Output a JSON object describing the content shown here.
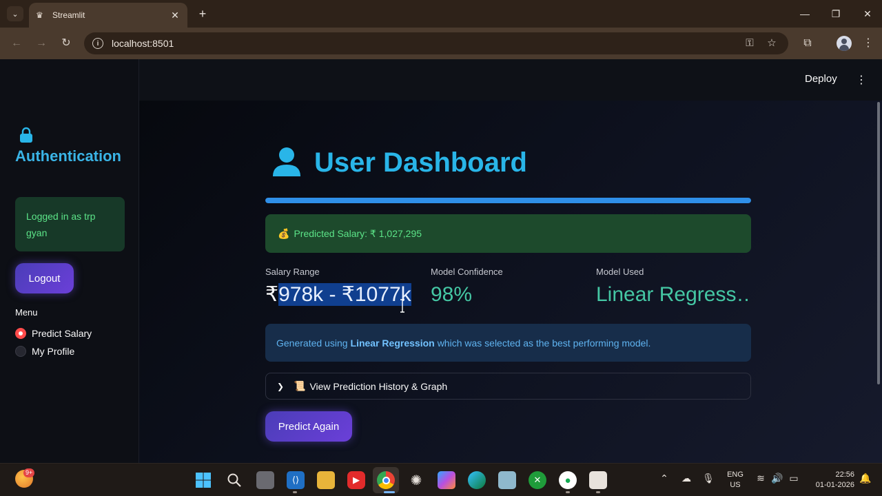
{
  "browser": {
    "tab_title": "Streamlit",
    "url": "localhost:8501",
    "new_tab": "+",
    "close_tab": "✕",
    "minimize": "—",
    "restore": "❐",
    "close": "✕"
  },
  "header": {
    "deploy_label": "Deploy",
    "menu_glyph": "⋮"
  },
  "sidebar": {
    "title": "Authentication",
    "logged_in_text": "Logged in as trp gyan",
    "logout_label": "Logout",
    "menu_label": "Menu",
    "menu_items": [
      {
        "label": "Predict Salary",
        "selected": true
      },
      {
        "label": "My Profile",
        "selected": false
      }
    ]
  },
  "dashboard": {
    "title": "User Dashboard",
    "progress": 1.0,
    "success_icon": "💰",
    "success_text": "Predicted Salary: ₹ 1,027,295",
    "metrics": [
      {
        "label": "Salary Range",
        "value_prefix": "₹",
        "value_selected": "978k - ₹1077k"
      },
      {
        "label": "Model Confidence",
        "value": "98%"
      },
      {
        "label": "Model Used",
        "value": "Linear Regress…"
      }
    ],
    "info_before": "Generated using",
    "info_bold": "Linear Regression",
    "info_after": "which was selected as the best performing model.",
    "expander_icon": "📜",
    "expander_label": "View Prediction History & Graph",
    "predict_again_label": "Predict Again"
  },
  "taskbar": {
    "badge": "9+",
    "lang_line1": "ENG",
    "lang_line2": "US",
    "time": "22:56",
    "date": "01-01-2026"
  },
  "colors": {
    "accent_blue": "#29b5e8",
    "success_green": "#5ce488",
    "button_purple": "#5b3fd0",
    "metric_green": "#45c7a4"
  }
}
